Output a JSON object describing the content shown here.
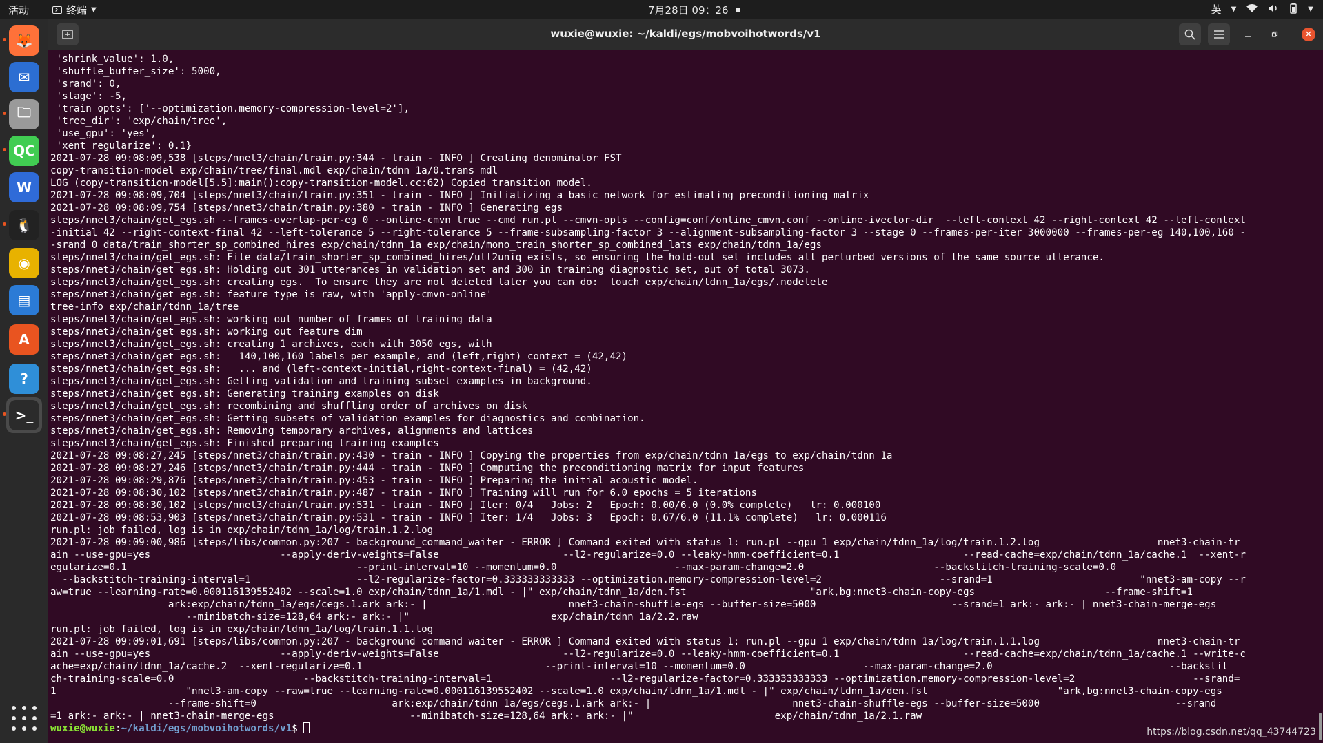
{
  "topbar": {
    "activities": "活动",
    "app_menu": "终端",
    "clock": "7月28日 09：26",
    "input_method": "英"
  },
  "dock": {
    "items": [
      {
        "name": "firefox-icon",
        "color": "#ff7139",
        "glyph": "🦊"
      },
      {
        "name": "thunderbird-icon",
        "color": "#2c6ed2",
        "glyph": "✉"
      },
      {
        "name": "files-icon",
        "color": "#9a9a9a",
        "glyph": "🗀"
      },
      {
        "name": "qtcreator-icon",
        "color": "#41cd52",
        "glyph": "QC"
      },
      {
        "name": "wps-icon",
        "color": "#2f6bd8",
        "glyph": "W"
      },
      {
        "name": "qq-icon",
        "color": "#222222",
        "glyph": "🐧"
      },
      {
        "name": "rhythmbox-icon",
        "color": "#e8b200",
        "glyph": "◉"
      },
      {
        "name": "writer-icon",
        "color": "#2b7bd6",
        "glyph": "▤"
      },
      {
        "name": "software-center-icon",
        "color": "#e95420",
        "glyph": "A"
      },
      {
        "name": "help-icon",
        "color": "#2f8fd8",
        "glyph": "?"
      },
      {
        "name": "terminal-icon",
        "color": "#2b2b2b",
        "glyph": ">_"
      }
    ]
  },
  "window": {
    "title": "wuxie@wuxie: ~/kaldi/egs/mobvoihotwords/v1"
  },
  "terminal": {
    "lines": [
      " 'shrink_value': 1.0,",
      " 'shuffle_buffer_size': 5000,",
      " 'srand': 0,",
      " 'stage': -5,",
      " 'train_opts': ['--optimization.memory-compression-level=2'],",
      " 'tree_dir': 'exp/chain/tree',",
      " 'use_gpu': 'yes',",
      " 'xent_regularize': 0.1}",
      "2021-07-28 09:08:09,538 [steps/nnet3/chain/train.py:344 - train - INFO ] Creating denominator FST",
      "copy-transition-model exp/chain/tree/final.mdl exp/chain/tdnn_1a/0.trans_mdl",
      "LOG (copy-transition-model[5.5]:main():copy-transition-model.cc:62) Copied transition model.",
      "2021-07-28 09:08:09,704 [steps/nnet3/chain/train.py:351 - train - INFO ] Initializing a basic network for estimating preconditioning matrix",
      "2021-07-28 09:08:09,754 [steps/nnet3/chain/train.py:380 - train - INFO ] Generating egs",
      "steps/nnet3/chain/get_egs.sh --frames-overlap-per-eg 0 --online-cmvn true --cmd run.pl --cmvn-opts --config=conf/online_cmvn.conf --online-ivector-dir  --left-context 42 --right-context 42 --left-context",
      "-initial 42 --right-context-final 42 --left-tolerance 5 --right-tolerance 5 --frame-subsampling-factor 3 --alignment-subsampling-factor 3 --stage 0 --frames-per-iter 3000000 --frames-per-eg 140,100,160 -",
      "-srand 0 data/train_shorter_sp_combined_hires exp/chain/tdnn_1a exp/chain/mono_train_shorter_sp_combined_lats exp/chain/tdnn_1a/egs",
      "steps/nnet3/chain/get_egs.sh: File data/train_shorter_sp_combined_hires/utt2uniq exists, so ensuring the hold-out set includes all perturbed versions of the same source utterance.",
      "steps/nnet3/chain/get_egs.sh: Holding out 301 utterances in validation set and 300 in training diagnostic set, out of total 3073.",
      "steps/nnet3/chain/get_egs.sh: creating egs.  To ensure they are not deleted later you can do:  touch exp/chain/tdnn_1a/egs/.nodelete",
      "steps/nnet3/chain/get_egs.sh: feature type is raw, with 'apply-cmvn-online'",
      "tree-info exp/chain/tdnn_1a/tree",
      "steps/nnet3/chain/get_egs.sh: working out number of frames of training data",
      "steps/nnet3/chain/get_egs.sh: working out feature dim",
      "steps/nnet3/chain/get_egs.sh: creating 1 archives, each with 3050 egs, with",
      "steps/nnet3/chain/get_egs.sh:   140,100,160 labels per example, and (left,right) context = (42,42)",
      "steps/nnet3/chain/get_egs.sh:   ... and (left-context-initial,right-context-final) = (42,42)",
      "steps/nnet3/chain/get_egs.sh: Getting validation and training subset examples in background.",
      "steps/nnet3/chain/get_egs.sh: Generating training examples on disk",
      "steps/nnet3/chain/get_egs.sh: recombining and shuffling order of archives on disk",
      "steps/nnet3/chain/get_egs.sh: Getting subsets of validation examples for diagnostics and combination.",
      "steps/nnet3/chain/get_egs.sh: Removing temporary archives, alignments and lattices",
      "steps/nnet3/chain/get_egs.sh: Finished preparing training examples",
      "2021-07-28 09:08:27,245 [steps/nnet3/chain/train.py:430 - train - INFO ] Copying the properties from exp/chain/tdnn_1a/egs to exp/chain/tdnn_1a",
      "2021-07-28 09:08:27,246 [steps/nnet3/chain/train.py:444 - train - INFO ] Computing the preconditioning matrix for input features",
      "2021-07-28 09:08:29,876 [steps/nnet3/chain/train.py:453 - train - INFO ] Preparing the initial acoustic model.",
      "2021-07-28 09:08:30,102 [steps/nnet3/chain/train.py:487 - train - INFO ] Training will run for 6.0 epochs = 5 iterations",
      "2021-07-28 09:08:30,102 [steps/nnet3/chain/train.py:531 - train - INFO ] Iter: 0/4   Jobs: 2   Epoch: 0.00/6.0 (0.0% complete)   lr: 0.000100",
      "2021-07-28 09:08:53,903 [steps/nnet3/chain/train.py:531 - train - INFO ] Iter: 1/4   Jobs: 3   Epoch: 0.67/6.0 (11.1% complete)   lr: 0.000116",
      "run.pl: job failed, log is in exp/chain/tdnn_1a/log/train.1.2.log",
      "2021-07-28 09:09:00,986 [steps/libs/common.py:207 - background_command_waiter - ERROR ] Command exited with status 1: run.pl --gpu 1 exp/chain/tdnn_1a/log/train.1.2.log                    nnet3-chain-tr",
      "ain --use-gpu=yes                      --apply-deriv-weights=False                     --l2-regularize=0.0 --leaky-hmm-coefficient=0.1                     --read-cache=exp/chain/tdnn_1a/cache.1  --xent-r",
      "egularize=0.1                                       --print-interval=10 --momentum=0.0                    --max-param-change=2.0                      --backstitch-training-scale=0.0",
      "  --backstitch-training-interval=1                  --l2-regularize-factor=0.333333333333 --optimization.memory-compression-level=2                    --srand=1                         \"nnet3-am-copy --r",
      "aw=true --learning-rate=0.000116139552402 --scale=1.0 exp/chain/tdnn_1a/1.mdl - |\" exp/chain/tdnn_1a/den.fst                     \"ark,bg:nnet3-chain-copy-egs                      --frame-shift=1",
      "                    ark:exp/chain/tdnn_1a/egs/cegs.1.ark ark:- |                        nnet3-chain-shuffle-egs --buffer-size=5000                       --srand=1 ark:- ark:- | nnet3-chain-merge-egs",
      "                       --minibatch-size=128,64 ark:- ark:- |\"                        exp/chain/tdnn_1a/2.2.raw",
      "run.pl: job failed, log is in exp/chain/tdnn_1a/log/train.1.1.log",
      "2021-07-28 09:09:01,691 [steps/libs/common.py:207 - background_command_waiter - ERROR ] Command exited with status 1: run.pl --gpu 1 exp/chain/tdnn_1a/log/train.1.1.log                    nnet3-chain-tr",
      "ain --use-gpu=yes                      --apply-deriv-weights=False                     --l2-regularize=0.0 --leaky-hmm-coefficient=0.1                     --read-cache=exp/chain/tdnn_1a/cache.1 --write-c",
      "ache=exp/chain/tdnn_1a/cache.2  --xent-regularize=0.1                               --print-interval=10 --momentum=0.0                    --max-param-change=2.0                              --backstit",
      "ch-training-scale=0.0                      --backstitch-training-interval=1                    --l2-regularize-factor=0.333333333333 --optimization.memory-compression-level=2                    --srand=",
      "1                      \"nnet3-am-copy --raw=true --learning-rate=0.000116139552402 --scale=1.0 exp/chain/tdnn_1a/1.mdl - |\" exp/chain/tdnn_1a/den.fst                      \"ark,bg:nnet3-chain-copy-egs",
      "                    --frame-shift=0                       ark:exp/chain/tdnn_1a/egs/cegs.1.ark ark:- |                        nnet3-chain-shuffle-egs --buffer-size=5000                       --srand",
      "=1 ark:- ark:- | nnet3-chain-merge-egs                       --minibatch-size=128,64 ark:- ark:- |\"                        exp/chain/tdnn_1a/2.1.raw"
    ],
    "prompt_user": "wuxie@wuxie",
    "prompt_sep": ":",
    "prompt_path": "~/kaldi/egs/mobvoihotwords/v1",
    "prompt_symbol": "$ ",
    "watermark": "https://blog.csdn.net/qq_43744723"
  }
}
